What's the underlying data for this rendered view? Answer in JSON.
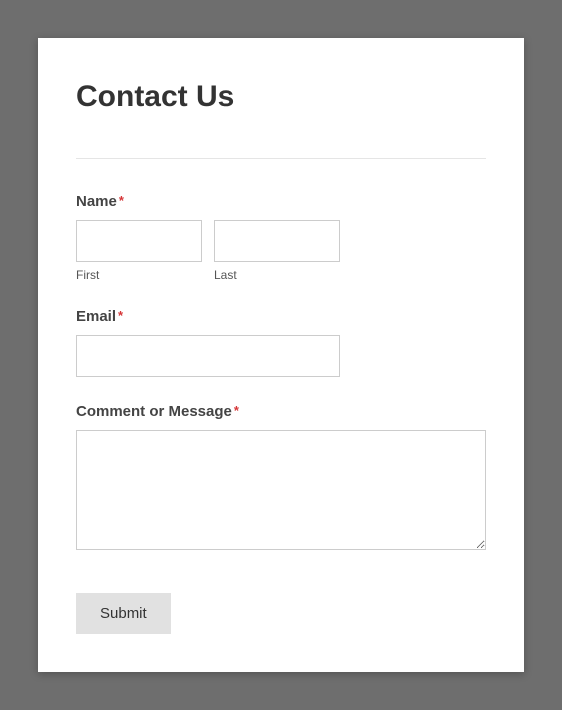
{
  "title": "Contact Us",
  "required_marker": "*",
  "fields": {
    "name": {
      "label": "Name",
      "first": {
        "sublabel": "First",
        "value": ""
      },
      "last": {
        "sublabel": "Last",
        "value": ""
      }
    },
    "email": {
      "label": "Email",
      "value": ""
    },
    "message": {
      "label": "Comment or Message",
      "value": ""
    }
  },
  "submit_label": "Submit"
}
